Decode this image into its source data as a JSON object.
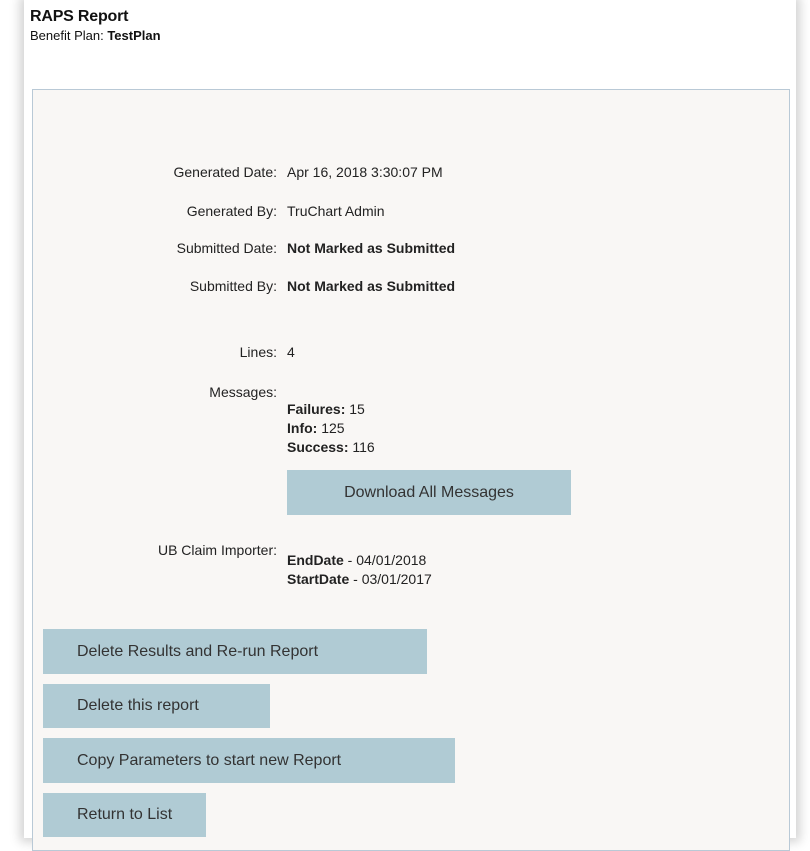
{
  "header": {
    "title": "RAPS Report",
    "plan_label": "Benefit Plan: ",
    "plan_value": "TestPlan"
  },
  "details": {
    "generated_date_label": "Generated Date:",
    "generated_date_value": "Apr 16, 2018 3:30:07 PM",
    "generated_by_label": "Generated By:",
    "generated_by_value": "TruChart Admin",
    "submitted_date_label": "Submitted Date:",
    "submitted_date_value": "Not Marked as Submitted",
    "submitted_by_label": "Submitted By:",
    "submitted_by_value": "Not Marked as Submitted",
    "lines_label": "Lines:",
    "lines_value": "4"
  },
  "messages": {
    "label": "Messages:",
    "failures_label": "Failures:",
    "failures_value": " 15",
    "info_label": "Info:",
    "info_value": " 125",
    "success_label": "Success:",
    "success_value": " 116",
    "download_button": "Download All Messages"
  },
  "importer": {
    "label": "UB Claim Importer:",
    "end_label": "EndDate",
    "end_value": " - 04/01/2018",
    "start_label": "StartDate",
    "start_value": " - 03/01/2017"
  },
  "actions": {
    "delete_rerun": "Delete Results and Re-run Report",
    "delete_report": "Delete this report",
    "copy_params": "Copy Parameters to start new Report",
    "return_list": "Return to List"
  },
  "colors": {
    "button_bg": "#b0cbd4",
    "panel_bg": "#f9f7f5",
    "panel_border": "#b9c9d6"
  }
}
